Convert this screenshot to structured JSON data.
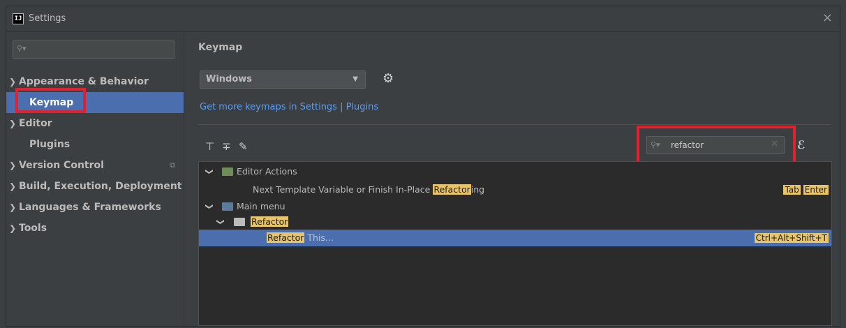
{
  "window": {
    "title": "Settings",
    "logo_text": "IJ",
    "close_glyph": "×"
  },
  "sidebar": {
    "search_placeholder": "",
    "items": [
      {
        "label": "Appearance & Behavior",
        "expandable": true
      },
      {
        "label": "Keymap",
        "expandable": false,
        "selected": true
      },
      {
        "label": "Editor",
        "expandable": true
      },
      {
        "label": "Plugins",
        "expandable": false
      },
      {
        "label": "Version Control",
        "expandable": true,
        "has_badge_icon": true
      },
      {
        "label": "Build, Execution, Deployment",
        "expandable": true
      },
      {
        "label": "Languages & Frameworks",
        "expandable": true
      },
      {
        "label": "Tools",
        "expandable": true
      }
    ]
  },
  "main": {
    "title": "Keymap",
    "keymap_select": {
      "value": "Windows"
    },
    "get_more_link": "Get more keymaps in Settings | Plugins",
    "search": {
      "value": "refactor"
    },
    "tree": {
      "editor_actions": {
        "label": "Editor Actions"
      },
      "next_template": {
        "prefix": "Next Template Variable or Finish In-Place ",
        "match": "Refactor",
        "suffix": "ing",
        "shortcuts": [
          "Tab",
          "Enter"
        ]
      },
      "main_menu": {
        "label": "Main menu"
      },
      "refactor_folder": {
        "match": "Refactor"
      },
      "refactor_this": {
        "match": "Refactor",
        "suffix": " This...",
        "shortcut": "Ctrl+Alt+Shift+T"
      }
    }
  },
  "colors": {
    "accent_selection": "#4b6eaf",
    "highlight": "#e8c46a",
    "annotation_red": "#e1212e",
    "link": "#589df6"
  }
}
